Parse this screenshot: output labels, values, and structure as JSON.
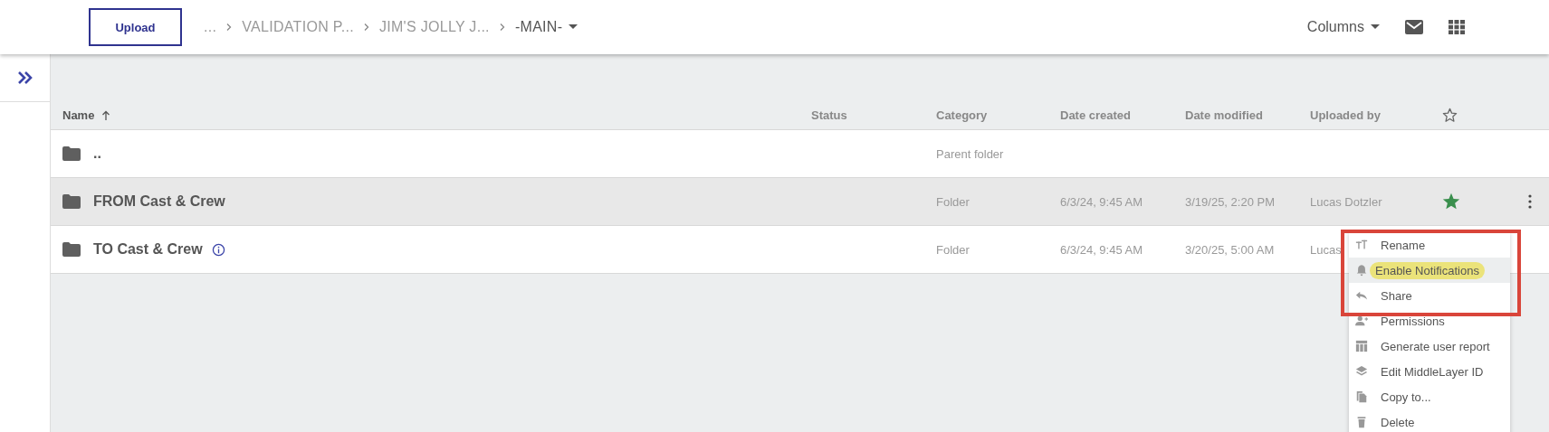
{
  "toolbar": {
    "upload_button": "Upload",
    "breadcrumbs": [
      {
        "label": "...",
        "current": false
      },
      {
        "label": "VALIDATION P...",
        "current": false
      },
      {
        "label": "JIM'S JOLLY J...",
        "current": false
      },
      {
        "label": "-MAIN-",
        "current": true
      }
    ],
    "columns_button": "Columns"
  },
  "table": {
    "columns": [
      {
        "label": "Name",
        "sorted": true
      },
      {
        "label": "Status",
        "sorted": false
      },
      {
        "label": "Category",
        "sorted": false
      },
      {
        "label": "Date created",
        "sorted": false
      },
      {
        "label": "Date modified",
        "sorted": false
      },
      {
        "label": "Uploaded by",
        "sorted": false
      }
    ],
    "rows": [
      {
        "name": "..",
        "info": false,
        "category": "Parent folder",
        "created": "",
        "modified": "",
        "uploaded_by": "",
        "starred": false,
        "selected": false
      },
      {
        "name": "FROM Cast & Crew",
        "info": false,
        "category": "Folder",
        "created": "6/3/24, 9:45 AM",
        "modified": "3/19/25, 2:20 PM",
        "uploaded_by": "Lucas Dotzler",
        "starred": true,
        "selected": true
      },
      {
        "name": "TO Cast & Crew",
        "info": true,
        "category": "Folder",
        "created": "6/3/24, 9:45 AM",
        "modified": "3/20/25, 5:00 AM",
        "uploaded_by": "Lucas",
        "starred": false,
        "selected": false
      }
    ]
  },
  "context_menu": {
    "annotation_frame": true,
    "items": [
      {
        "kind": "rename",
        "label": "Rename",
        "selected": false
      },
      {
        "kind": "bell",
        "label": "Enable Notifications",
        "selected": true
      },
      {
        "kind": "share",
        "label": "Share",
        "selected": false
      },
      {
        "kind": "people",
        "label": "Permissions",
        "selected": false
      },
      {
        "kind": "table",
        "label": "Generate user report",
        "selected": false
      },
      {
        "kind": "layers",
        "label": "Edit MiddleLayer ID",
        "selected": false
      },
      {
        "kind": "copy",
        "label": "Copy to...",
        "selected": false
      },
      {
        "kind": "trash",
        "label": "Delete",
        "selected": false
      }
    ]
  }
}
